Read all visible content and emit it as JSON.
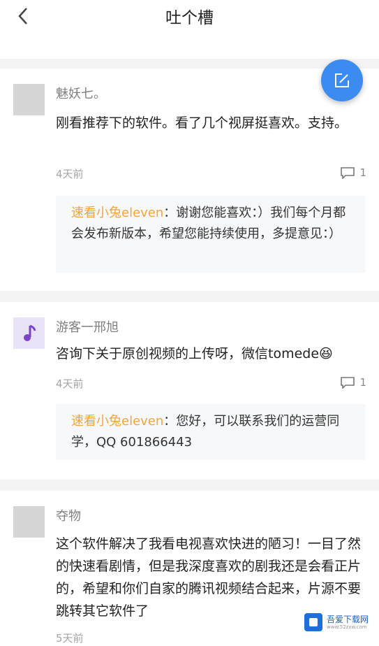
{
  "header": {
    "title": "吐个槽"
  },
  "comments": [
    {
      "author": "魅妖七。",
      "content": "刚看推荐下的软件。看了几个视屏挺喜欢。支持。",
      "time": "4天前",
      "reply_count": "1",
      "reply": {
        "author": "速看小兔eleven",
        "separator": "：",
        "text": "谢谢您能喜欢：）我们每个月都会发布新版本，希望您能持续使用，多提意见：）"
      }
    },
    {
      "author": "游客一邢旭",
      "content": "咨询下关于原创视频的上传呀，微信tomede😆",
      "time": "4天前",
      "reply_count": "1",
      "reply": {
        "author": "速看小兔eleven",
        "separator": "：",
        "text": "您好，可以联系我们的运营同学，QQ 601866443"
      }
    },
    {
      "author": "夺物",
      "content": "这个软件解决了我看电视喜欢快进的陋习！一目了然的快速看剧情，但是我深度喜欢的剧我还是会看正片的，希望和你们自家的腾讯视频结合起来，片源不要跳转其它软件了",
      "time": "5天前"
    }
  ],
  "watermark": {
    "text": "吾爱下载网",
    "sub": "www.52zxw.com"
  },
  "colors": {
    "accent": "#3b8bf0",
    "reply_author": "#f4a43a"
  }
}
